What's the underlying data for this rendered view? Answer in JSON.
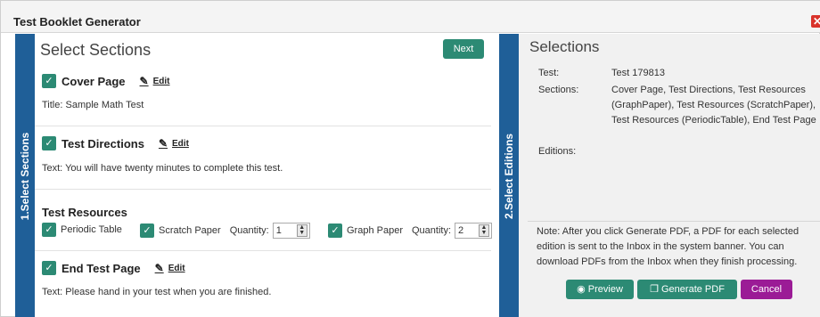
{
  "window": {
    "title": "Test Booklet Generator",
    "close_icon": "close-icon"
  },
  "tabs": {
    "select_sections": "1.Select Sections",
    "select_editions": "2.Select Editions"
  },
  "left": {
    "header": "Select Sections",
    "next_label": "Next",
    "edit_label": "Edit",
    "cover": {
      "title": "Cover Page",
      "text": "Title: Sample Math Test"
    },
    "directions": {
      "title": "Test Directions",
      "text": "Text: You will have twenty minutes to complete this test."
    },
    "resources": {
      "title": "Test Resources",
      "periodic": "Periodic Table",
      "scratch": "Scratch Paper",
      "graph": "Graph Paper",
      "quantity_label": "Quantity:",
      "scratch_qty": "1",
      "graph_qty": "2"
    },
    "endpage": {
      "title": "End Test Page",
      "text": "Text: Please hand in your test when you are finished."
    }
  },
  "right": {
    "header": "Selections",
    "test_label": "Test:",
    "test_value": "Test 179813",
    "sections_label": "Sections:",
    "sections_value": "Cover Page, Test Directions, Test Resources (GraphPaper), Test Resources (ScratchPaper), Test Resources (PeriodicTable), End Test Page",
    "editions_label": "Editions:",
    "note": "Note: After you click Generate PDF, a PDF for each selected edition is sent to the Inbox in the system banner. You can download PDFs from the Inbox when they finish processing.",
    "preview_label": "Preview",
    "generate_label": "Generate PDF",
    "cancel_label": "Cancel"
  },
  "colors": {
    "accent": "#2c8a74",
    "tab": "#1f5f98",
    "cancel": "#9b1b96",
    "close": "#d9332b"
  }
}
